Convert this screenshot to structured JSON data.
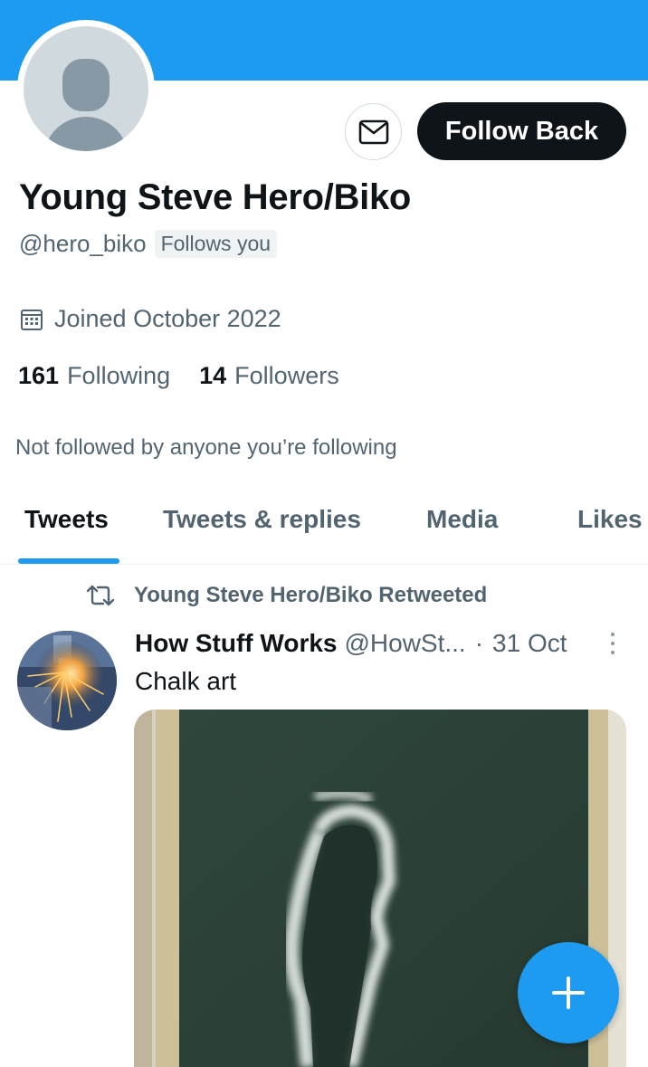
{
  "profile": {
    "name": "Young Steve Hero/Biko",
    "handle": "@hero_biko",
    "follows_you": "Follows you",
    "joined": "Joined October 2022",
    "following_count": "161",
    "following_label": "Following",
    "followers_count": "14",
    "followers_label": "Followers",
    "not_followed": "Not followed by anyone you’re following"
  },
  "actions": {
    "message_icon": "envelope-icon",
    "follow_back_label": "Follow Back"
  },
  "tabs": [
    {
      "label": "Tweets",
      "active": true
    },
    {
      "label": "Tweets & replies",
      "active": false
    },
    {
      "label": "Media",
      "active": false
    },
    {
      "label": "Likes",
      "active": false
    }
  ],
  "tweet": {
    "retweet_context": "Young Steve Hero/Biko Retweeted",
    "author_name": "How Stuff Works",
    "author_handle": "@HowSt...",
    "separator": "·",
    "date": "31 Oct",
    "text": "Chalk art"
  },
  "fab": {
    "icon": "plus-icon"
  },
  "colors": {
    "accent": "#1d9bf0",
    "text_primary": "#0f1419",
    "text_secondary": "#536471",
    "follow_button_bg": "#0f1419"
  }
}
